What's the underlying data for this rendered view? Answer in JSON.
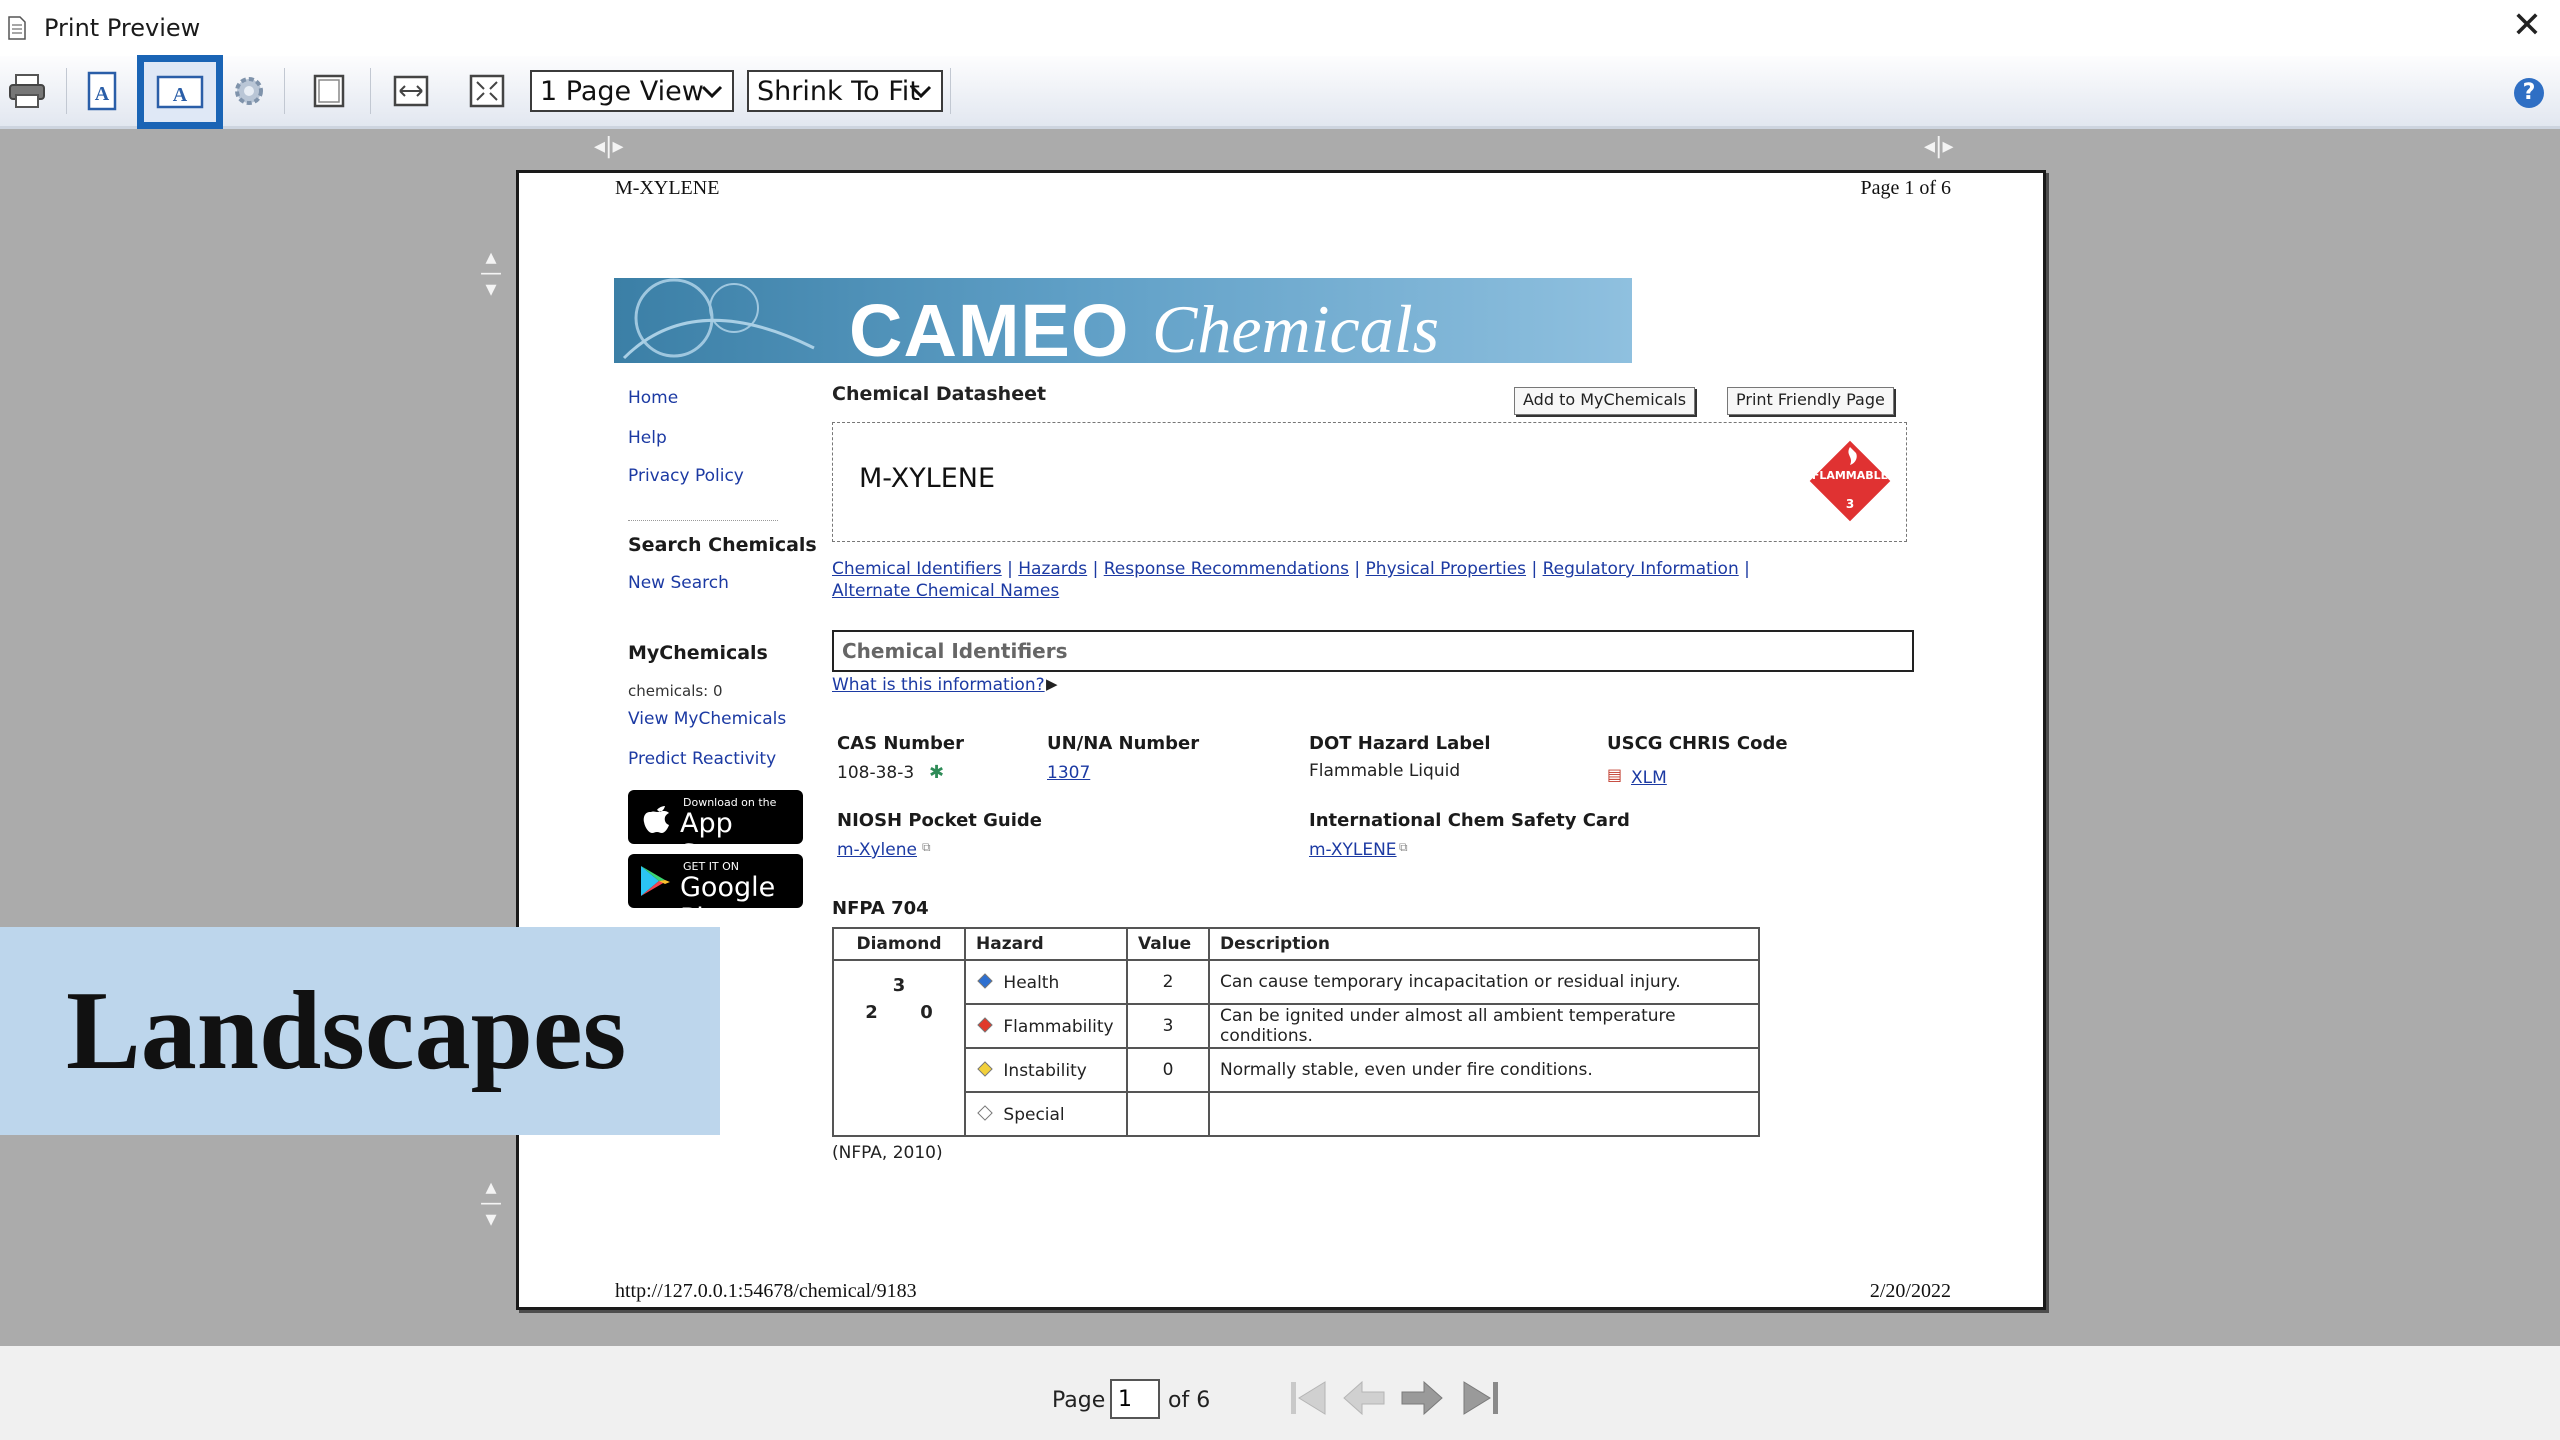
{
  "window": {
    "title": "Print Preview"
  },
  "toolbar": {
    "view_select": "1 Page View",
    "fit_select": "Shrink To Fit"
  },
  "page": {
    "header_left": "M-XYLENE",
    "header_right": "Page 1 of 6",
    "footer_left": "http://127.0.0.1:54678/chemical/9183",
    "footer_right": "2/20/2022",
    "banner": {
      "cameo": "CAMEO",
      "chemicals": "Chemicals"
    },
    "sidebar": {
      "home": "Home",
      "help": "Help",
      "privacy": "Privacy Policy",
      "search_heading": "Search Chemicals",
      "new_search": "New Search",
      "mychem_heading": "MyChemicals",
      "chem_count": "chemicals: 0",
      "view_mychem": "View MyChemicals",
      "predict": "Predict Reactivity",
      "appstore_small": "Download on the",
      "appstore_big": "App Store",
      "gplay_small": "GET IT ON",
      "gplay_big": "Google Play"
    },
    "datasheet_title": "Chemical Datasheet",
    "add_button": "Add to MyChemicals",
    "print_button": "Print Friendly Page",
    "chem_name": "M-XYLENE",
    "placard_text": "FLAMMABLE",
    "placard_num": "3",
    "links": {
      "ids": "Chemical Identifiers",
      "hazards": "Hazards",
      "response": "Response Recommendations",
      "physical": "Physical Properties",
      "regulatory": "Regulatory Information",
      "alternate": "Alternate Chemical Names",
      "sep": "|"
    },
    "section_title": "Chemical Identifiers",
    "what_info": "What is this information?",
    "cas": {
      "label": "CAS Number",
      "value": "108-38-3"
    },
    "unna": {
      "label": "UN/NA Number",
      "value": "1307"
    },
    "dot": {
      "label": "DOT Hazard Label",
      "value": "Flammable Liquid"
    },
    "uscg": {
      "label": "USCG CHRIS Code",
      "value": "XLM"
    },
    "niosh": {
      "label": "NIOSH Pocket Guide",
      "value": "m-Xylene"
    },
    "icsc": {
      "label": "International Chem Safety Card",
      "value": "m-XYLENE"
    },
    "nfpa": {
      "title": "NFPA 704",
      "headers": [
        "Diamond",
        "Hazard",
        "Value",
        "Description"
      ],
      "diamond_top": "3",
      "diamond_left": "2",
      "diamond_right": "0",
      "rows": [
        {
          "hazard": "Health",
          "value": "2",
          "desc": "Can cause temporary incapacitation or residual injury.",
          "color": "#2d6fd0"
        },
        {
          "hazard": "Flammability",
          "value": "3",
          "desc": "Can be ignited under almost all ambient temperature conditions.",
          "color": "#e0392b"
        },
        {
          "hazard": "Instability",
          "value": "0",
          "desc": "Normally stable, even under fire conditions.",
          "color": "#f2d03a"
        },
        {
          "hazard": "Special",
          "value": "",
          "desc": "",
          "color": "#ffffff"
        }
      ],
      "source": "(NFPA, 2010)"
    }
  },
  "overlay": {
    "text": "Landscapes"
  },
  "status": {
    "page_label": "Page",
    "page_value": "1",
    "of_label": "of 6"
  },
  "colors": {
    "accent": "#1a64b5",
    "link": "#1c3aa3",
    "overlay": "#bdd6ec"
  }
}
